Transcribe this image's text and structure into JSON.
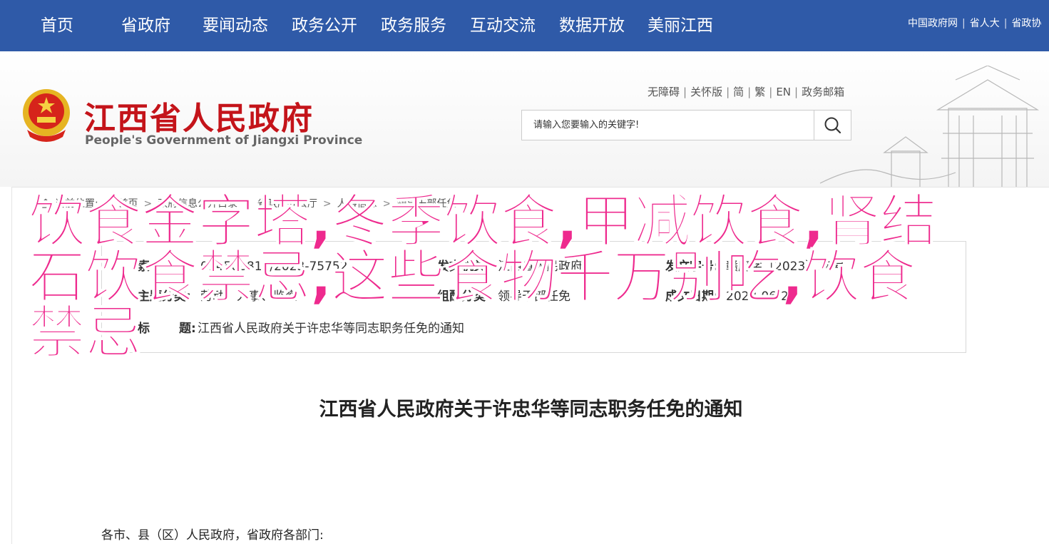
{
  "nav": {
    "items": [
      "首页",
      "省政府",
      "要闻动态",
      "政务公开",
      "政务服务",
      "互动交流",
      "数据开放",
      "美丽江西"
    ],
    "right_links": [
      "中国政府网",
      "省人大",
      "省政协"
    ]
  },
  "header": {
    "title": "江西省人民政府",
    "subtitle": "People's Government of Jiangxi Province",
    "util_links": [
      "无障碍",
      "关怀版",
      "简",
      "繁",
      "EN",
      "政务邮箱"
    ],
    "search_placeholder": "请输入您要输入的关键字!"
  },
  "breadcrumb": {
    "label": "当前位置:",
    "items": [
      "首页",
      "政府信息公开目录",
      "省政府办公厅",
      "人事信息",
      "领导干部任免"
    ]
  },
  "meta": {
    "row1_key": "索",
    "row1_val": "014508810/2023-75752",
    "row2_key": "主题分类:",
    "row2_val": "劳动、人事、监察",
    "row3_key": "标",
    "row3_key2": "题:",
    "row3_val": "江西省人民政府关于许忠华等同志职务任免的通知",
    "issuer_key": "发文机关:",
    "issuer_val": "江西省人民政府",
    "docno_key": "发文字号:",
    "docno_val": "赣府字〔2023〕18号",
    "date_key": "成文日期:",
    "date_val": "2023-06-28",
    "genre_key": "组配分类:",
    "genre_val": "领导干部任免"
  },
  "document": {
    "title": "江西省人民政府关于许忠华等同志职务任免的通知",
    "salutation": "各市、县（区）人民政府，省政府各部门:"
  },
  "overlay": {
    "text": "饮食金字塔,冬季饮食,甲减饮食,肾结石饮食禁忌,这些食物千万别吃,饮食禁忌"
  },
  "colors": {
    "nav_bg": "#2f5aa8",
    "title_red": "#c4141a",
    "overlay_pink": "#ee2a8e"
  }
}
